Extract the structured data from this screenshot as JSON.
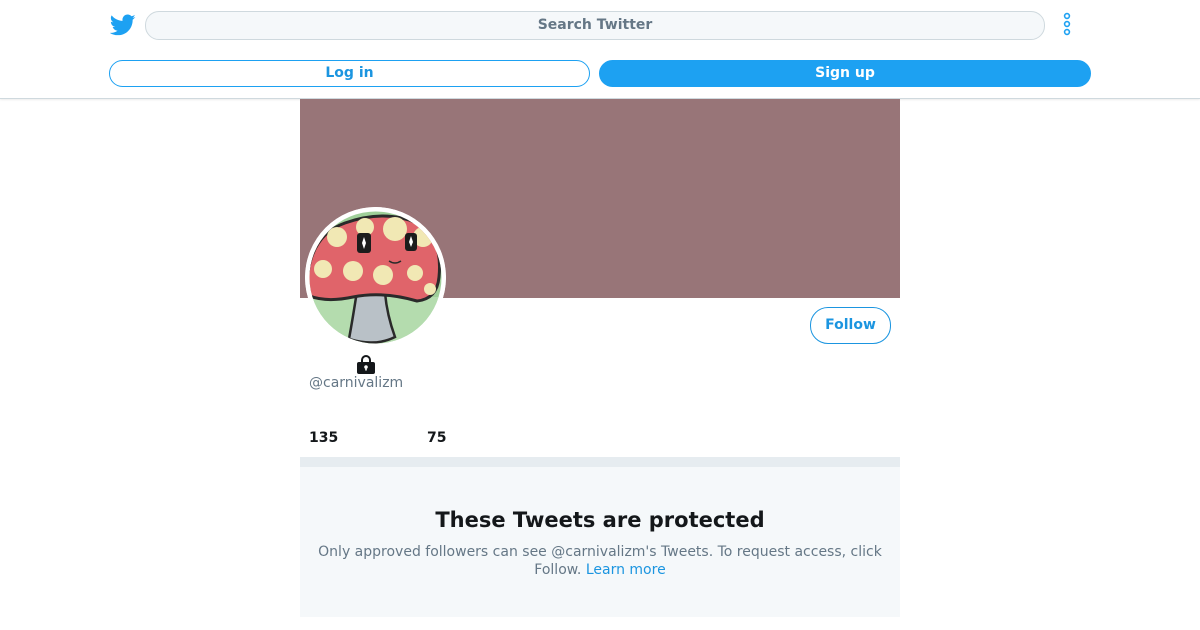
{
  "header": {
    "logo_icon": "twitter-bird-icon",
    "search_placeholder": "Search Twitter",
    "more_icon": "more-options-icon",
    "login_label": "Log in",
    "signup_label": "Sign up"
  },
  "profile": {
    "banner_color": "#987578",
    "avatar_icon": "mushroom-avatar",
    "follow_label": "Follow",
    "lock_icon": "lock-icon",
    "handle": "@carnivalizm",
    "stats": [
      "135",
      "75"
    ]
  },
  "protected": {
    "title": "These Tweets are protected",
    "message": "Only approved followers can see @carnivalizm's Tweets. To request access, click Follow.",
    "learn_more": "Learn more"
  },
  "colors": {
    "accent": "#1da1f2",
    "link": "#1b95e0",
    "muted_text": "#657786",
    "panel_bg": "#f5f8fa"
  }
}
